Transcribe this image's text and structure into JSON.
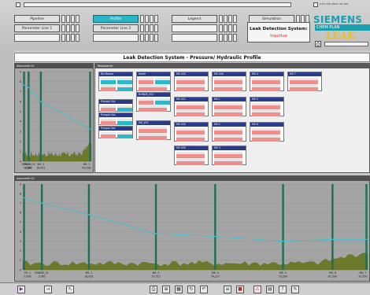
{
  "header": {
    "nav_buttons": [
      {
        "label": "Pipeline",
        "active": false
      },
      {
        "label": "Profile",
        "active": true
      },
      {
        "label": "Legend",
        "active": false
      },
      {
        "label": "Simulation",
        "active": false
      }
    ],
    "sub_buttons": [
      {
        "label": "Parameter Line 1"
      },
      {
        "label": "Parameter Line 2"
      }
    ],
    "status_label": "Leak Detection System:",
    "status_value": "Inactive",
    "status_color": "#d9262a",
    "brand": "SIEMENS",
    "product_sub": "CHEM PLAN",
    "product_name": "LEAK"
  },
  "page_title": "Leak Detection System - Pressure/ Hydraulic Profile",
  "upper_chart": {
    "title": "Abschnitt 01",
    "station_labels": [
      {
        "name": "PS. 1",
        "value": "0,000"
      },
      {
        "name": "RONDE_V1",
        "value": "5,362"
      },
      {
        "name": "MS. 2",
        "value": "16,631"
      },
      {
        "name": "MS. 1",
        "value": "63,290"
      }
    ]
  },
  "lower_chart": {
    "title": "Abschnitt 02",
    "station_labels": [
      {
        "name": "PS. 1",
        "value": "0,000"
      },
      {
        "name": "RONDE_V1",
        "value": "5,362"
      },
      {
        "name": "MS. 2",
        "value": "18,631"
      },
      {
        "name": "MS. 3",
        "value": "37,515"
      },
      {
        "name": "MS. 4",
        "value": "54,227"
      },
      {
        "name": "MS. 5",
        "value": "73,350"
      },
      {
        "name": "MS. 6",
        "value": "87,300"
      },
      {
        "name": "MS. 7",
        "value": "97,200"
      }
    ]
  },
  "chart_data": [
    {
      "type": "line",
      "title": "Abschnitt 01",
      "x": [
        0,
        5.362,
        16.631,
        63.29
      ],
      "series": [
        {
          "values": [
            7.7,
            7.4,
            6.0,
            3.2
          ]
        }
      ],
      "ylim": [
        0,
        9
      ],
      "yticks": [
        "9",
        "8",
        "7",
        "6",
        "5",
        "4",
        "3",
        "2",
        "1",
        "0"
      ]
    },
    {
      "type": "line",
      "title": "Abschnitt 02",
      "x": [
        0,
        5.362,
        18.631,
        37.515,
        54.227,
        73.35,
        87.3,
        97.2
      ],
      "series": [
        {
          "values": [
            7.6,
            7.0,
            5.8,
            3.8,
            3.5,
            3.0,
            3.2,
            3.2
          ]
        }
      ],
      "ylim": [
        0,
        9
      ],
      "yticks": [
        "9",
        "8",
        "7",
        "6",
        "5",
        "4",
        "3",
        "2",
        "1",
        "0"
      ]
    }
  ],
  "measurement": {
    "title": "Messwerte"
  },
  "cards": [
    {
      "title": "De Messw",
      "rows": [
        [
          "cyan",
          "cyan"
        ],
        [
          "red",
          "cyan"
        ]
      ]
    },
    {
      "title": "Pumpst Gut",
      "rows": [
        [
          "red",
          "cyan"
        ]
      ]
    },
    {
      "title": "Pumpst Gut",
      "rows": [
        [
          "red",
          "cyan"
        ]
      ]
    },
    {
      "title": "Pumpst Gut",
      "rows": [
        [
          "red",
          "cyan"
        ]
      ]
    },
    {
      "title": "Ventil",
      "rows": [
        [
          "red",
          "cyan"
        ],
        [
          "red"
        ]
      ]
    },
    {
      "title": "RONDE_V01",
      "rows": [
        [
          "red",
          "cyan"
        ],
        [
          "red"
        ]
      ]
    },
    {
      "title": "MS_V01",
      "rows": [
        [
          "red"
        ],
        [
          "red"
        ]
      ]
    },
    {
      "title": "MS 020",
      "rows": [
        [
          "red"
        ],
        [
          "red"
        ]
      ]
    },
    {
      "title": "MS 021",
      "rows": [
        [
          "red"
        ],
        [
          "red"
        ]
      ]
    },
    {
      "title": "MS 034",
      "rows": [
        [
          "red"
        ],
        [
          "red"
        ]
      ]
    },
    {
      "title": "MS 035",
      "rows": [
        [
          "red"
        ],
        [
          "red"
        ]
      ]
    },
    {
      "title": "MS 040",
      "rows": [
        [
          "red"
        ],
        [
          "red"
        ]
      ]
    },
    {
      "title": "MS 1",
      "rows": [
        [
          "red"
        ],
        [
          "red"
        ]
      ]
    },
    {
      "title": "MS 2",
      "rows": [
        [
          "red"
        ],
        [
          "red"
        ]
      ]
    },
    {
      "title": "MS 3",
      "rows": [
        [
          "red"
        ],
        [
          "red"
        ]
      ]
    },
    {
      "title": "MS 4",
      "rows": [
        [
          "red"
        ],
        [
          "red"
        ]
      ]
    },
    {
      "title": "MS 5",
      "rows": [
        [
          "red"
        ],
        [
          "red"
        ]
      ]
    },
    {
      "title": "MS 6",
      "rows": [
        [
          "red"
        ],
        [
          "red"
        ]
      ]
    },
    {
      "title": "MS 7",
      "rows": [
        [
          "red"
        ],
        [
          "red"
        ]
      ]
    }
  ],
  "bottom_toolbar": {
    "icons": [
      "play-icon",
      "arrow-right-icon",
      "cursor-icon",
      "print-icon",
      "zoom-icon",
      "grid-icon",
      "refresh-icon",
      "undo-icon",
      "layers-icon",
      "stop-icon",
      "alarm-icon",
      "chart-icon",
      "help-icon",
      "pen-icon"
    ]
  }
}
